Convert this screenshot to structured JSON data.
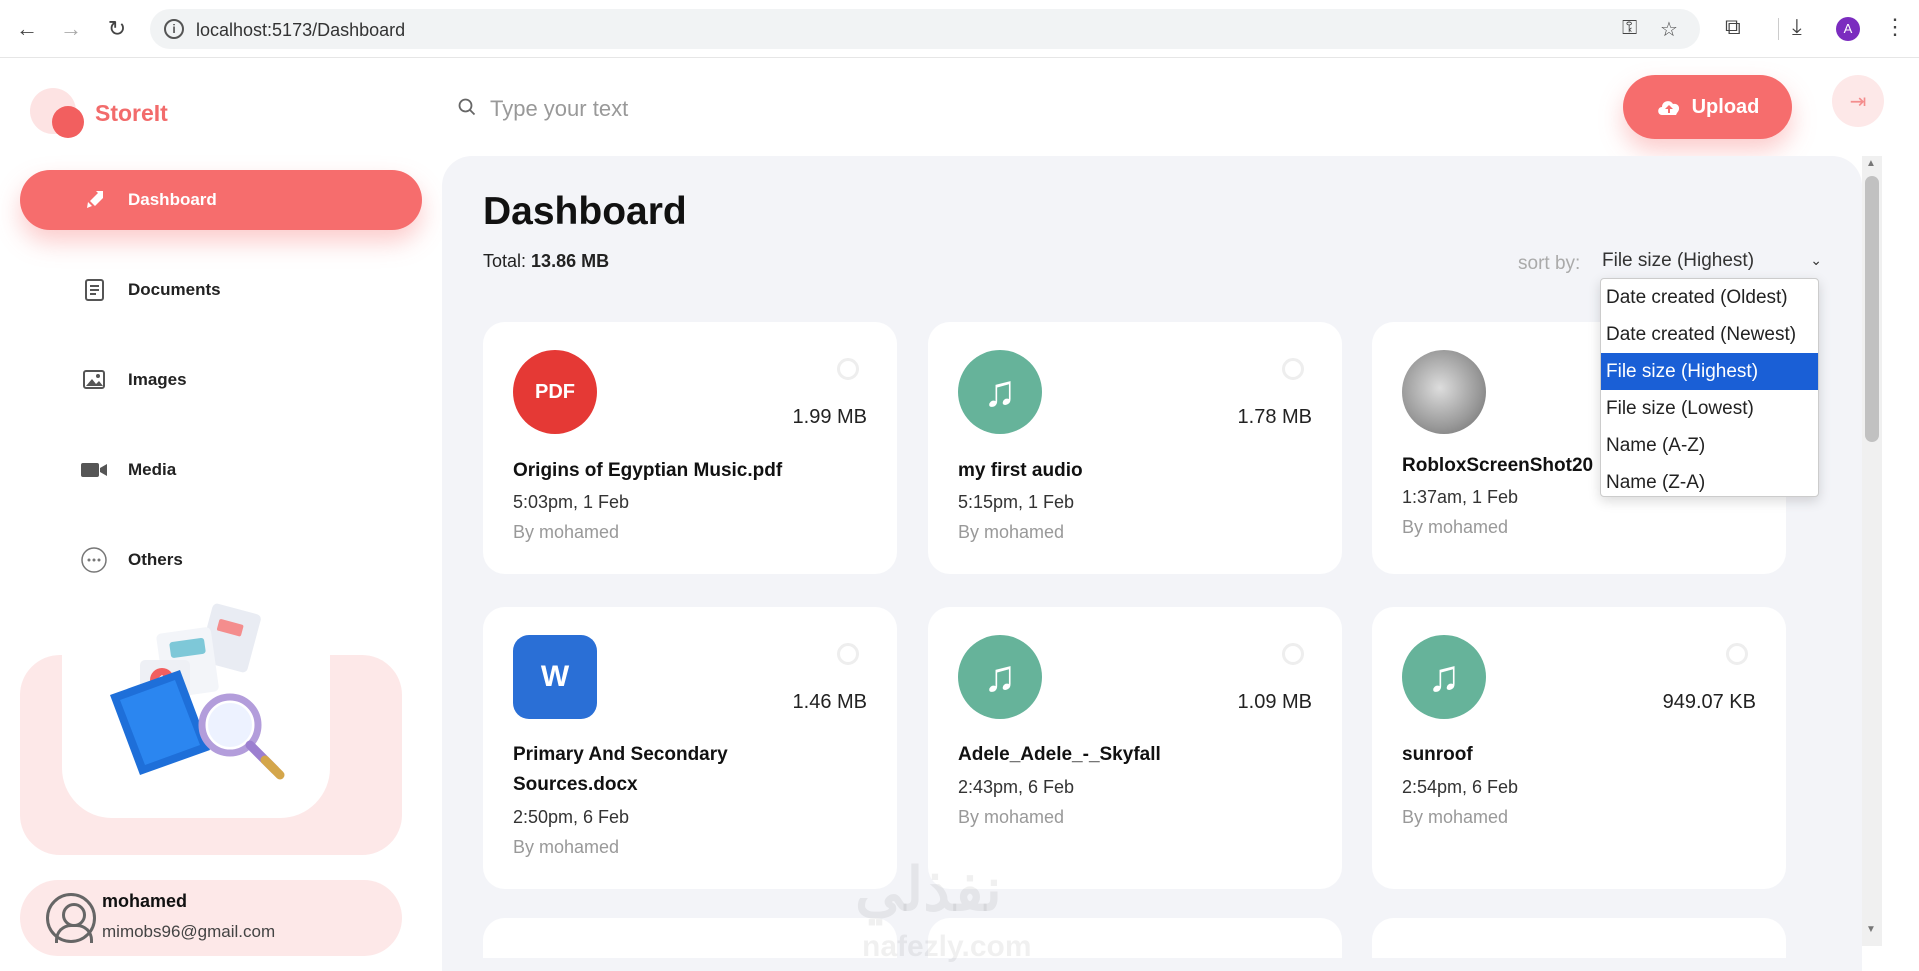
{
  "browser": {
    "url": "localhost:5173/Dashboard",
    "avatar_letter": "A"
  },
  "app": {
    "name": "StoreIt",
    "accent_color": "#f66d6d"
  },
  "sidebar": {
    "items": [
      {
        "label": "Dashboard",
        "icon": "rocket-icon",
        "active": true
      },
      {
        "label": "Documents",
        "icon": "documents-icon",
        "active": false
      },
      {
        "label": "Images",
        "icon": "images-icon",
        "active": false
      },
      {
        "label": "Media",
        "icon": "video-camera-icon",
        "active": false
      },
      {
        "label": "Others",
        "icon": "more-circle-icon",
        "active": false
      }
    ]
  },
  "user": {
    "name": "mohamed",
    "email": "mimobs96@gmail.com"
  },
  "header": {
    "search_placeholder": "Type your text",
    "upload_label": "Upload"
  },
  "main": {
    "title": "Dashboard",
    "total_label": "Total:",
    "total_value": "13.86 MB",
    "sort_label": "sort by:",
    "sort_selected": "File size (Highest)",
    "sort_options": [
      "Date created (Oldest)",
      "Date created (Newest)",
      "File size (Highest)",
      "File size (Lowest)",
      "Name (A-Z)",
      "Name (Z-A)"
    ]
  },
  "files": [
    {
      "name": "Origins of Egyptian Music.pdf",
      "size": "1.99 MB",
      "date": "5:03pm, 1 Feb",
      "owner": "By mohamed",
      "type": "pdf",
      "icon_text": "PDF"
    },
    {
      "name": "my first audio",
      "size": "1.78 MB",
      "date": "5:15pm, 1 Feb",
      "owner": "By mohamed",
      "type": "audio",
      "icon_text": "♫"
    },
    {
      "name": "RobloxScreenShot20",
      "size": "",
      "date": "1:37am, 1 Feb",
      "owner": "By mohamed",
      "type": "image",
      "icon_text": ""
    },
    {
      "name": "Primary And Secondary Sources.docx",
      "size": "1.46 MB",
      "date": "2:50pm, 6 Feb",
      "owner": "By mohamed",
      "type": "docx",
      "icon_text": "W"
    },
    {
      "name": "Adele_Adele_-_Skyfall",
      "size": "1.09 MB",
      "date": "2:43pm, 6 Feb",
      "owner": "By mohamed",
      "type": "audio",
      "icon_text": "♫"
    },
    {
      "name": "sunroof",
      "size": "949.07 KB",
      "date": "2:54pm, 6 Feb",
      "owner": "By mohamed",
      "type": "audio",
      "icon_text": "♫"
    }
  ],
  "watermark": {
    "text": "نفذلي",
    "sub": "nafezly.com"
  }
}
